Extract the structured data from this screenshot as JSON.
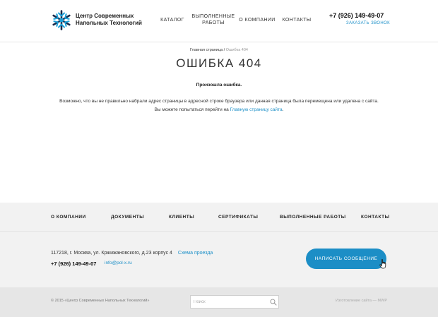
{
  "header": {
    "logo_line1": "Центр Современных",
    "logo_line2": "Напольных Технологий",
    "nav": [
      {
        "line1": "КАТАЛОГ",
        "line2": ""
      },
      {
        "line1": "ВЫПОЛНЕННЫЕ",
        "line2": "РАБОТЫ"
      },
      {
        "line1": "О КОМПАНИИ",
        "line2": ""
      },
      {
        "line1": "КОНТАКТЫ",
        "line2": ""
      }
    ],
    "phone": "+7 (926) 149-49-07",
    "callback": "ЗАКАЗАТЬ ЗВОНОК"
  },
  "breadcrumb": {
    "home": "Главная страница",
    "separator": " / ",
    "current": "Ошибка 404"
  },
  "main": {
    "title": "ОШИБКА 404",
    "subtitle": "Произошла ошибка.",
    "desc_line1": "Возможно, что вы не правильно набрали адрес страницы в адресной строке браузера или данная страница была перемещена или удалена с сайта.",
    "desc_line2_prefix": "Вы можете попытаться перейти на ",
    "desc_line2_link": "Главную страницу сайта",
    "desc_line2_suffix": "."
  },
  "footer_nav": [
    "О КОМПАНИИ",
    "ДОКУМЕНТЫ",
    "КЛИЕНТЫ",
    "СЕРТИФИКАТЫ",
    "ВЫПОЛНЕННЫЕ РАБОТЫ",
    "КОНТАКТЫ"
  ],
  "contacts": {
    "address": "117218, г. Москва, ул. Кржижановского, д.23 корпус 4",
    "map_link": "Схема проезда",
    "phone": "+7 (926) 149-49-07",
    "email": "info@pol-x.ru",
    "message_button": "НАПИСАТЬ СООБЩЕНИЕ"
  },
  "bottom": {
    "copyright": "© 2015 «Центр Современных Напольных Технологий»",
    "search_placeholder": "Поиск",
    "developer": "Изготовление сайта — MWP"
  },
  "colors": {
    "accent": "#1c8ec6",
    "link": "#1e90c8",
    "band": "#f2f2f2",
    "bottom_band": "#e6e6e6"
  },
  "icons": {
    "logo": "snowflake-logo-icon",
    "search": "search-icon",
    "cursor": "hand-pointer-icon"
  }
}
